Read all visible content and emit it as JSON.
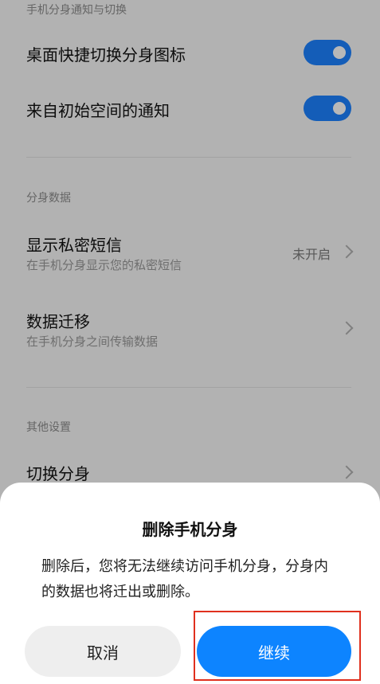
{
  "sections": {
    "notifications_title": "手机分身通知与切换",
    "data_title": "分身数据",
    "other_title": "其他设置"
  },
  "rows": {
    "desktop_shortcut": {
      "title": "桌面快捷切换分身图标",
      "enabled": true
    },
    "initial_space_notify": {
      "title": "来自初始空间的通知",
      "enabled": true
    },
    "private_sms": {
      "title": "显示私密短信",
      "subtitle": "在手机分身显示您的私密短信",
      "value": "未开启"
    },
    "data_migration": {
      "title": "数据迁移",
      "subtitle": "在手机分身之间传输数据"
    },
    "switch_profile": {
      "title": "切换分身"
    }
  },
  "dialog": {
    "title": "删除手机分身",
    "message": "删除后，您将无法继续访问手机分身，分身内的数据也将迁出或删除。",
    "cancel_label": "取消",
    "continue_label": "继续"
  },
  "colors": {
    "accent": "#0d84ff",
    "toggle_on": "#1d82ff",
    "highlight_border": "#e0301e"
  }
}
